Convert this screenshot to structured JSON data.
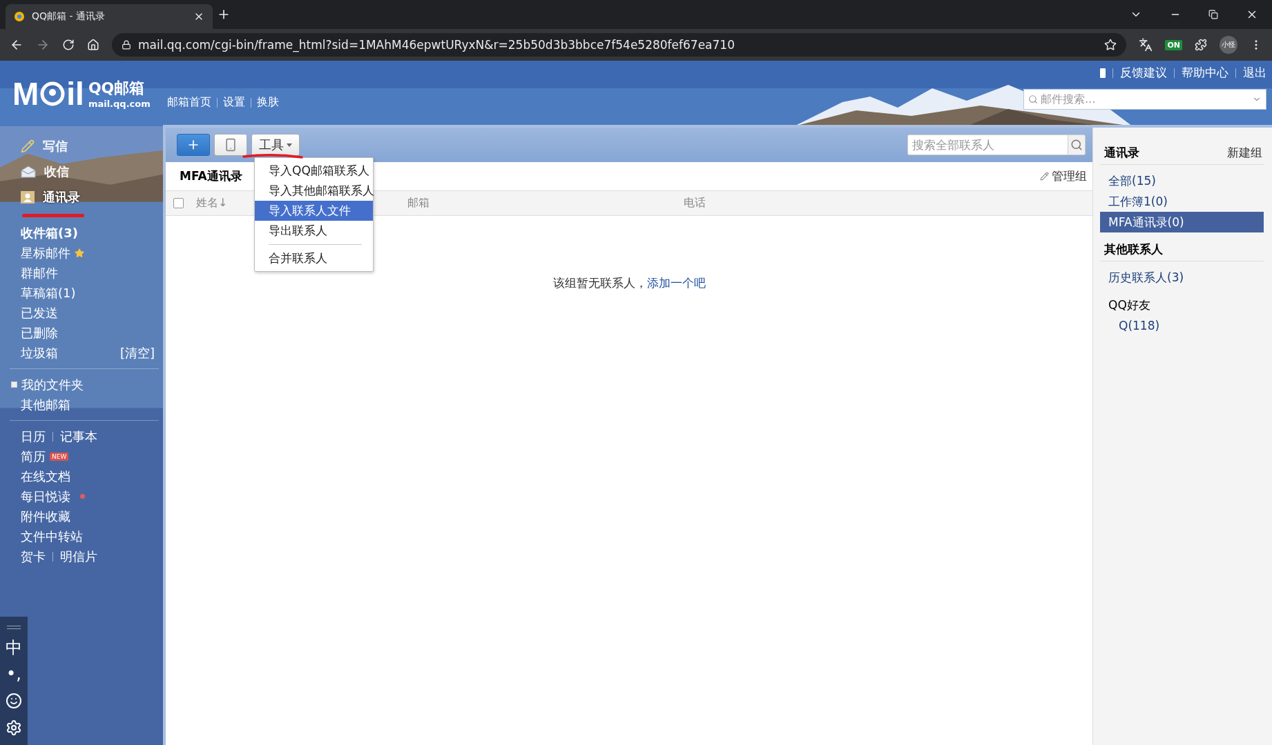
{
  "browser": {
    "tab_title": "QQ邮箱 - 通讯录",
    "url": "mail.qq.com/cgi-bin/frame_html?sid=1MAhM46epwtURyxN&r=25b50d3b3bbce7f54e5280fef67ea710",
    "extension_badge": "ON",
    "profile": "小怪"
  },
  "header": {
    "logo_left": "M",
    "logo_right": "il",
    "logo_title": "QQ邮箱",
    "logo_domain": "mail.qq.com",
    "nav": [
      "邮箱首页",
      "设置",
      "换肤"
    ],
    "links": [
      "反馈建议",
      "帮助中心",
      "退出"
    ],
    "search": {
      "placeholder": "邮件搜索..."
    }
  },
  "sidebar": {
    "actions": [
      {
        "label": "写信",
        "kind": "compose",
        "selected": false
      },
      {
        "label": "收信",
        "kind": "receive",
        "selected": false
      },
      {
        "label": "通讯录",
        "kind": "contacts",
        "selected": true
      }
    ],
    "folders": [
      {
        "label": "收件箱(3)",
        "kind": "unread"
      },
      {
        "label": "星标邮件",
        "kind": "starred"
      },
      {
        "label": "群邮件",
        "kind": "plain"
      },
      {
        "label": "草稿箱(1)",
        "kind": "plain"
      },
      {
        "label": "已发送",
        "kind": "plain"
      },
      {
        "label": "已删除",
        "kind": "plain"
      },
      {
        "label": "垃圾箱",
        "kind": "action",
        "action": "[清空]"
      }
    ],
    "my_folders": [
      {
        "label": "我的文件夹",
        "kind": "expandable"
      },
      {
        "label": "其他邮箱",
        "kind": "plain"
      }
    ],
    "apps": [
      {
        "kind": "pair",
        "labels": [
          "日历",
          "记事本"
        ]
      },
      {
        "kind": "new",
        "labels": [
          "简历"
        ],
        "badge": "NEW"
      },
      {
        "kind": "plain",
        "labels": [
          "在线文档"
        ]
      },
      {
        "kind": "dot",
        "labels": [
          "每日悦读"
        ]
      },
      {
        "kind": "plain",
        "labels": [
          "附件收藏"
        ]
      },
      {
        "kind": "plain",
        "labels": [
          "文件中转站"
        ]
      },
      {
        "kind": "pair",
        "labels": [
          "贺卡",
          "明信片"
        ]
      }
    ]
  },
  "ime_toolbar": {
    "mode": "中",
    "punctuation": "•,"
  },
  "toolbar": {
    "tools_label": "工具",
    "search": {
      "placeholder": "搜索全部联系人"
    }
  },
  "tools_menu": {
    "groups": [
      [
        {
          "label": "导入QQ邮箱联系人",
          "selected": false
        },
        {
          "label": "导入其他邮箱联系人",
          "selected": false
        },
        {
          "label": "导入联系人文件",
          "selected": true
        },
        {
          "label": "导出联系人",
          "selected": false
        }
      ],
      [
        {
          "label": "合并联系人",
          "selected": false
        }
      ]
    ]
  },
  "group": {
    "title": "MFA通讯录",
    "manage": "管理组"
  },
  "table": {
    "select_all": {
      "checked": false
    },
    "columns": [
      "姓名↓",
      "邮箱",
      "电话"
    ]
  },
  "empty": {
    "text": "该组暂无联系人，",
    "link": "添加一个吧"
  },
  "right_panel": {
    "title": "通讯录",
    "action": "新建组",
    "groups": [
      {
        "label": "全部(15)",
        "selected": false
      },
      {
        "label": "工作簿1(0)",
        "selected": false
      },
      {
        "label": "MFA通讯录(0)",
        "selected": true
      }
    ],
    "other_title": "其他联系人",
    "others": [
      {
        "label": "历史联系人(3)",
        "selected": false
      }
    ],
    "qq": {
      "title": "QQ好友",
      "children": [
        {
          "label": "Q(118)",
          "selected": false
        }
      ]
    }
  }
}
